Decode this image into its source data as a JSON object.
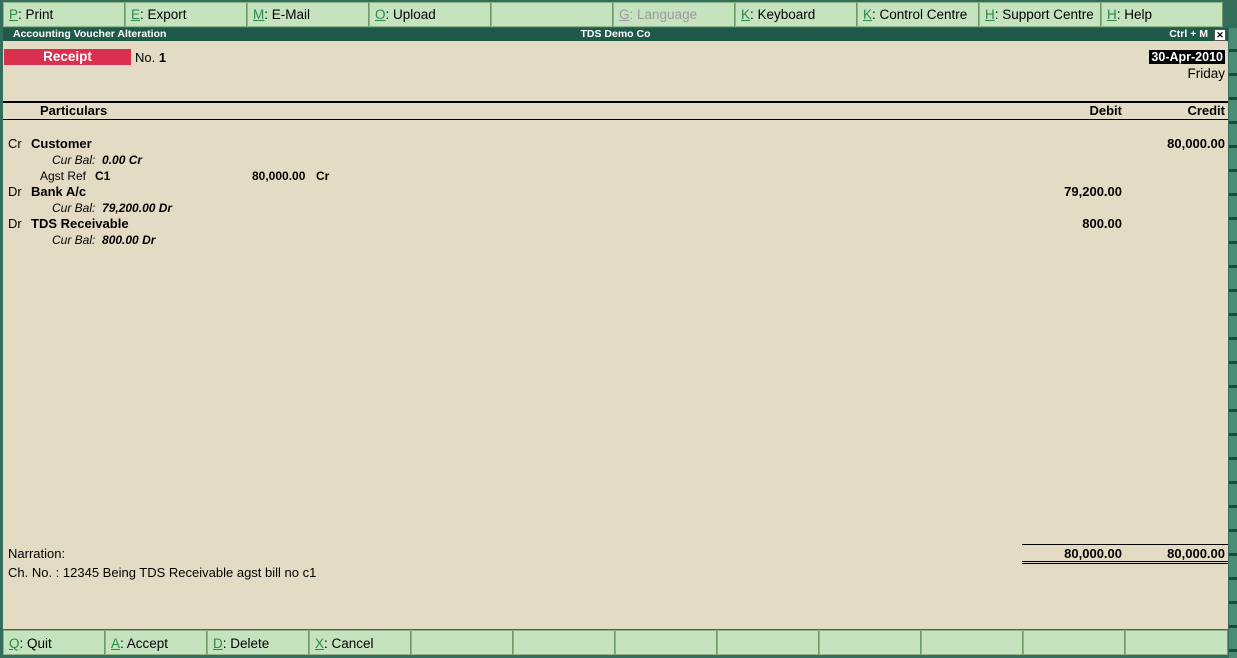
{
  "top_buttons": [
    {
      "key": "P",
      "label": ": Print",
      "enabled": true
    },
    {
      "key": "E",
      "label": ": Export",
      "enabled": true
    },
    {
      "key": "M",
      "label": ": E-Mail",
      "enabled": true
    },
    {
      "key": "O",
      "label": ": Upload",
      "enabled": true
    },
    {
      "key": "",
      "label": "",
      "enabled": true
    },
    {
      "key": "G",
      "label": ": Language",
      "enabled": false
    },
    {
      "key": "K",
      "label": ": Keyboard",
      "enabled": true
    },
    {
      "key": "K",
      "label": ": Control Centre",
      "enabled": true
    },
    {
      "key": "H",
      "label": ": Support Centre",
      "enabled": true
    },
    {
      "key": "H",
      "label": ": Help",
      "enabled": true
    }
  ],
  "titlebar": {
    "left": "Accounting Voucher  Alteration",
    "center": "TDS Demo Co",
    "right": "Ctrl + M",
    "close": "✕"
  },
  "voucher": {
    "type": "Receipt",
    "no_label": "No.",
    "no": "1",
    "date": "30-Apr-2010",
    "day": "Friday"
  },
  "columns": {
    "particulars": "Particulars",
    "debit": "Debit",
    "credit": "Credit"
  },
  "entries": {
    "customer": {
      "dc": "Cr",
      "ledger": "Customer",
      "credit": "80,000.00",
      "curbal_label": "Cur Bal:",
      "curbal": "0.00 Cr",
      "ref_label": "Agst Ref",
      "ref_name": "C1",
      "ref_amount": "80,000.00",
      "ref_dc": "Cr"
    },
    "bank": {
      "dc": "Dr",
      "ledger": "Bank A/c",
      "debit": "79,200.00",
      "curbal_label": "Cur Bal:",
      "curbal": "79,200.00 Dr"
    },
    "tds": {
      "dc": "Dr",
      "ledger": "TDS Receivable",
      "debit": "800.00",
      "curbal_label": "Cur Bal:",
      "curbal": "800.00 Dr"
    }
  },
  "narration": {
    "label": "Narration:",
    "text": "Ch. No. : 12345 Being TDS Receivable agst bill no c1"
  },
  "totals": {
    "debit": "80,000.00",
    "credit": "80,000.00"
  },
  "bottom_buttons": [
    {
      "key": "Q",
      "label": ": Quit"
    },
    {
      "key": "A",
      "label": ": Accept"
    },
    {
      "key": "D",
      "label": ": Delete"
    },
    {
      "key": "X",
      "label": ": Cancel"
    },
    {
      "key": "",
      "label": ""
    },
    {
      "key": "",
      "label": ""
    },
    {
      "key": "",
      "label": ""
    },
    {
      "key": "",
      "label": ""
    },
    {
      "key": "",
      "label": ""
    },
    {
      "key": "",
      "label": ""
    },
    {
      "key": "",
      "label": ""
    },
    {
      "key": "",
      "label": ""
    }
  ]
}
